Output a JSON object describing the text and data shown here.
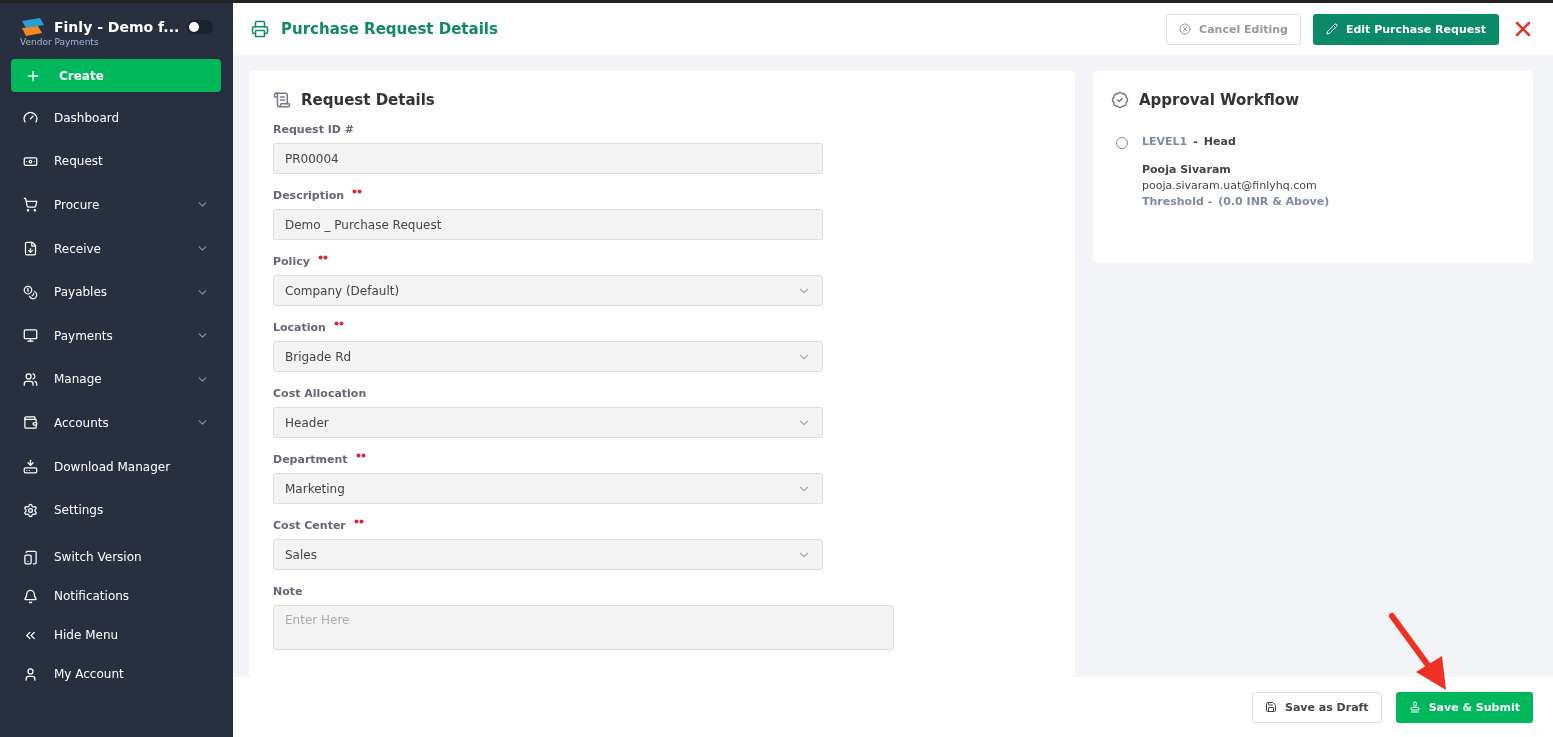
{
  "brand": {
    "name": "Finly - Demo f...",
    "subtitle": "Vendor Payments",
    "toggle_on": false
  },
  "create_button": {
    "label": "Create"
  },
  "menu": [
    {
      "label": "Dashboard",
      "expandable": false
    },
    {
      "label": "Request",
      "expandable": false
    },
    {
      "label": "Procure",
      "expandable": true
    },
    {
      "label": "Receive",
      "expandable": true
    },
    {
      "label": "Payables",
      "expandable": true
    },
    {
      "label": "Payments",
      "expandable": true
    },
    {
      "label": "Manage",
      "expandable": true
    },
    {
      "label": "Accounts",
      "expandable": true
    },
    {
      "label": "Download Manager",
      "expandable": false
    },
    {
      "label": "Settings",
      "expandable": false
    }
  ],
  "bottom_menu": [
    {
      "label": "Switch Version"
    },
    {
      "label": "Notifications"
    },
    {
      "label": "Hide Menu"
    },
    {
      "label": "My Account"
    }
  ],
  "header": {
    "title": "Purchase Request Details",
    "buttons": [
      {
        "kind": "outline",
        "label": "Cancel Editing"
      },
      {
        "kind": "primary",
        "label": "Edit Purchase Request"
      }
    ]
  },
  "request_details": {
    "title": "Request Details",
    "fields": [
      {
        "label": "Request ID #",
        "required": false,
        "kind": "text",
        "value": "PR00004"
      },
      {
        "label": "Description",
        "required": true,
        "kind": "text",
        "value": "Demo _ Purchase Request"
      },
      {
        "label": "Policy",
        "required": true,
        "kind": "select",
        "value": "Company (Default)"
      },
      {
        "label": "Location",
        "required": true,
        "kind": "select",
        "value": "Brigade Rd"
      },
      {
        "label": "Cost Allocation",
        "required": false,
        "kind": "select",
        "value": "Header"
      },
      {
        "label": "Department",
        "required": true,
        "kind": "select",
        "value": "Marketing"
      },
      {
        "label": "Cost Center",
        "required": true,
        "kind": "select",
        "value": "Sales"
      },
      {
        "label": "Note",
        "required": false,
        "kind": "textarea",
        "placeholder": "Enter Here"
      }
    ]
  },
  "approval_workflow": {
    "title": "Approval Workflow",
    "levels": [
      {
        "level": "LEVEL1",
        "separator": "-",
        "role": "Head",
        "name": "Pooja Sivaram",
        "email": "pooja.sivaram.uat@finlyhq.com",
        "threshold_label": "Threshold -",
        "threshold": "(0.0 INR & Above)",
        "completed": false
      }
    ]
  },
  "footer": {
    "buttons": [
      {
        "kind": "outline",
        "label": "Save as Draft"
      },
      {
        "kind": "success",
        "label": "Save & Submit"
      }
    ]
  }
}
